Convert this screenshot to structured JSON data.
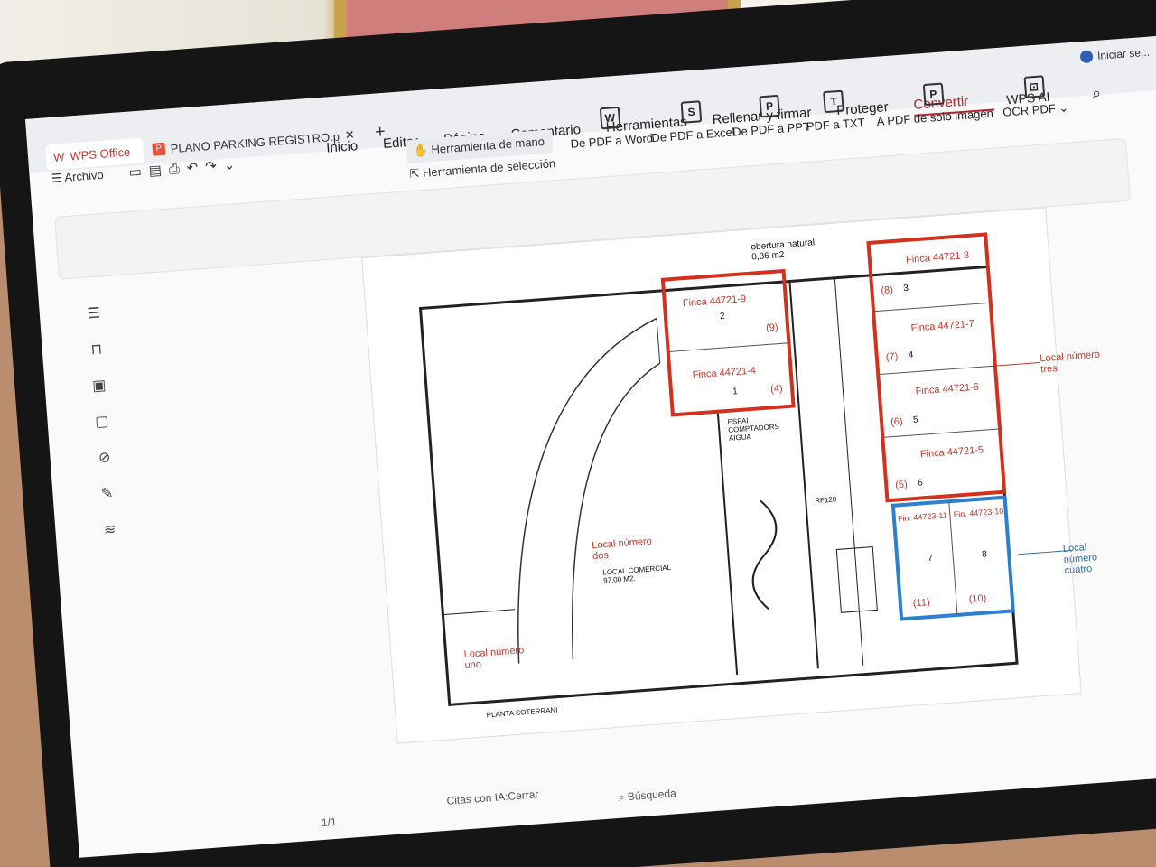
{
  "tabs": {
    "app": "WPS Office",
    "document": "PLANO PARKING REGISTRO.p"
  },
  "user": {
    "signin": "Iniciar se..."
  },
  "menu": {
    "items": [
      "Inicio",
      "Editar",
      "Página",
      "Comentario",
      "Herramientas",
      "Rellenar y firmar",
      "Proteger",
      "Convertir"
    ],
    "wps_ai": "WPS AI"
  },
  "toolbar": {
    "archivo": "Archivo",
    "hand_tool": "Herramienta de mano",
    "select_tool": "Herramienta de selección",
    "buttons": [
      {
        "label": "De PDF a Word",
        "icon": "W"
      },
      {
        "label": "De PDF a Excel",
        "icon": "S"
      },
      {
        "label": "De PDF a PPT",
        "icon": "P"
      },
      {
        "label": "PDF a TXT",
        "icon": "T"
      },
      {
        "label": "A PDF de solo imagen",
        "icon": "P"
      },
      {
        "label": "OCR PDF",
        "icon": "⊡"
      }
    ]
  },
  "plan": {
    "top_note": "obertura natural\n0,36 m2",
    "fincas_red": [
      {
        "name": "Finca 44721-9",
        "num": "2",
        "paren": "(9)"
      },
      {
        "name": "Finca 44721-4",
        "num": "1",
        "paren": "(4)"
      },
      {
        "name": "Finca 44721-8",
        "num": "3",
        "paren": "(8)"
      },
      {
        "name": "Finca 44721-7",
        "num": "4",
        "paren": "(7)"
      },
      {
        "name": "Finca 44721-6",
        "num": "5",
        "paren": "(6)"
      },
      {
        "name": "Finca 44721-5",
        "num": "6",
        "paren": "(5)"
      }
    ],
    "fincas_blue": [
      {
        "name": "Fin. 44723-11",
        "num": "7",
        "paren": "(11)"
      },
      {
        "name": "Fin. 44723-10",
        "num": "8",
        "paren": "(10)"
      }
    ],
    "local_tres": "Local número tres",
    "local_cuatro": "Local número cuatro",
    "local_dos": "Local número dos",
    "local_uno": "Local número uno",
    "local_comercial": "LOCAL COMERCIAL\n97,00 M2.",
    "espai_aigua": "ESPAI COMPTADORS AIGUA",
    "rf120": "RF120",
    "planta": "PLANTA SOTERRANI"
  },
  "status": {
    "page": "1/1",
    "citas": "Citas con IA:Cerrar",
    "busqueda": "Búsqueda"
  }
}
